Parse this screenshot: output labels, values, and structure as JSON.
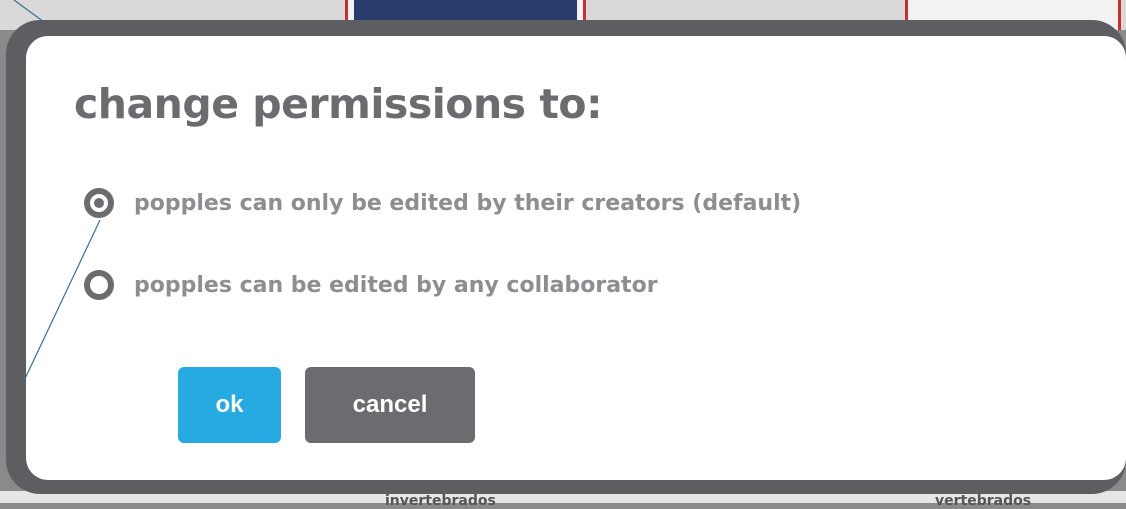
{
  "background": {
    "bottom_labels": [
      "invertebrados",
      "vertebrados"
    ]
  },
  "dialog": {
    "title": "change permissions to:",
    "options": [
      {
        "label": "popples can only be edited by their creators (default)",
        "selected": true
      },
      {
        "label": "popples can be edited by any collaborator",
        "selected": false
      }
    ],
    "ok_label": "ok",
    "cancel_label": "cancel"
  },
  "colors": {
    "ok_button": "#26aae1",
    "cancel_button": "#6c6c70",
    "frame": "#5e5e62"
  }
}
